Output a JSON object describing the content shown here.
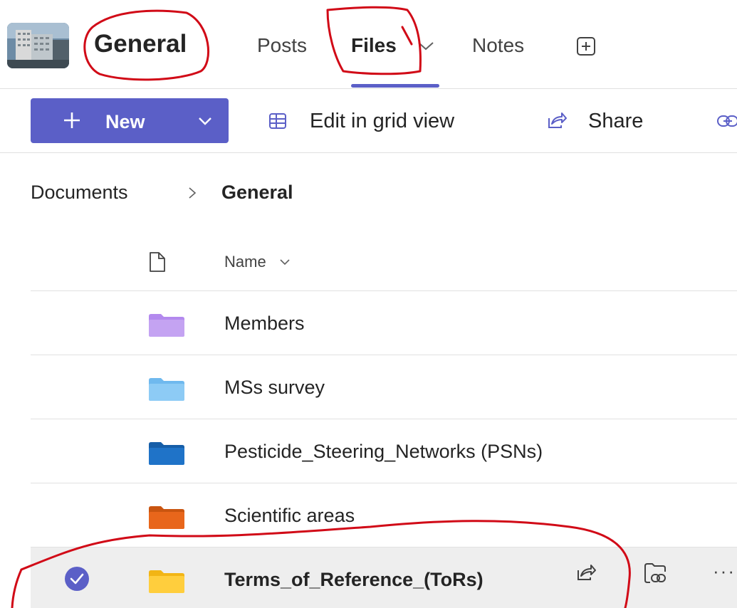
{
  "header": {
    "channel_title": "General",
    "tabs": [
      {
        "label": "Posts",
        "active": false
      },
      {
        "label": "Files",
        "active": true
      },
      {
        "label": "Notes",
        "active": false
      }
    ],
    "active_underline_color": "#5b5fc7"
  },
  "toolbar": {
    "new_label": "New",
    "edit_grid_label": "Edit in grid view",
    "share_label": "Share",
    "accent_color": "#5b5fc7"
  },
  "breadcrumb": {
    "items": [
      "Documents",
      "General"
    ]
  },
  "list": {
    "name_column_header": "Name",
    "rows": [
      {
        "name": "Members",
        "folder_color": "#c4a3f2",
        "folder_tab": "#b389ee",
        "selected": false
      },
      {
        "name": "MSs survey",
        "folder_color": "#8dcbf5",
        "folder_tab": "#6fb9ee",
        "selected": false
      },
      {
        "name": "Pesticide_Steering_Networks (PSNs)",
        "folder_color": "#1f73c8",
        "folder_tab": "#165ea8",
        "selected": false
      },
      {
        "name": "Scientific areas",
        "folder_color": "#e8661b",
        "folder_tab": "#c95510",
        "selected": false
      },
      {
        "name": "Terms_of_Reference_(ToRs)",
        "folder_color": "#ffce3d",
        "folder_tab": "#f2b515",
        "selected": true
      }
    ],
    "more_label": "···"
  },
  "annotation_color": "#d10a17"
}
